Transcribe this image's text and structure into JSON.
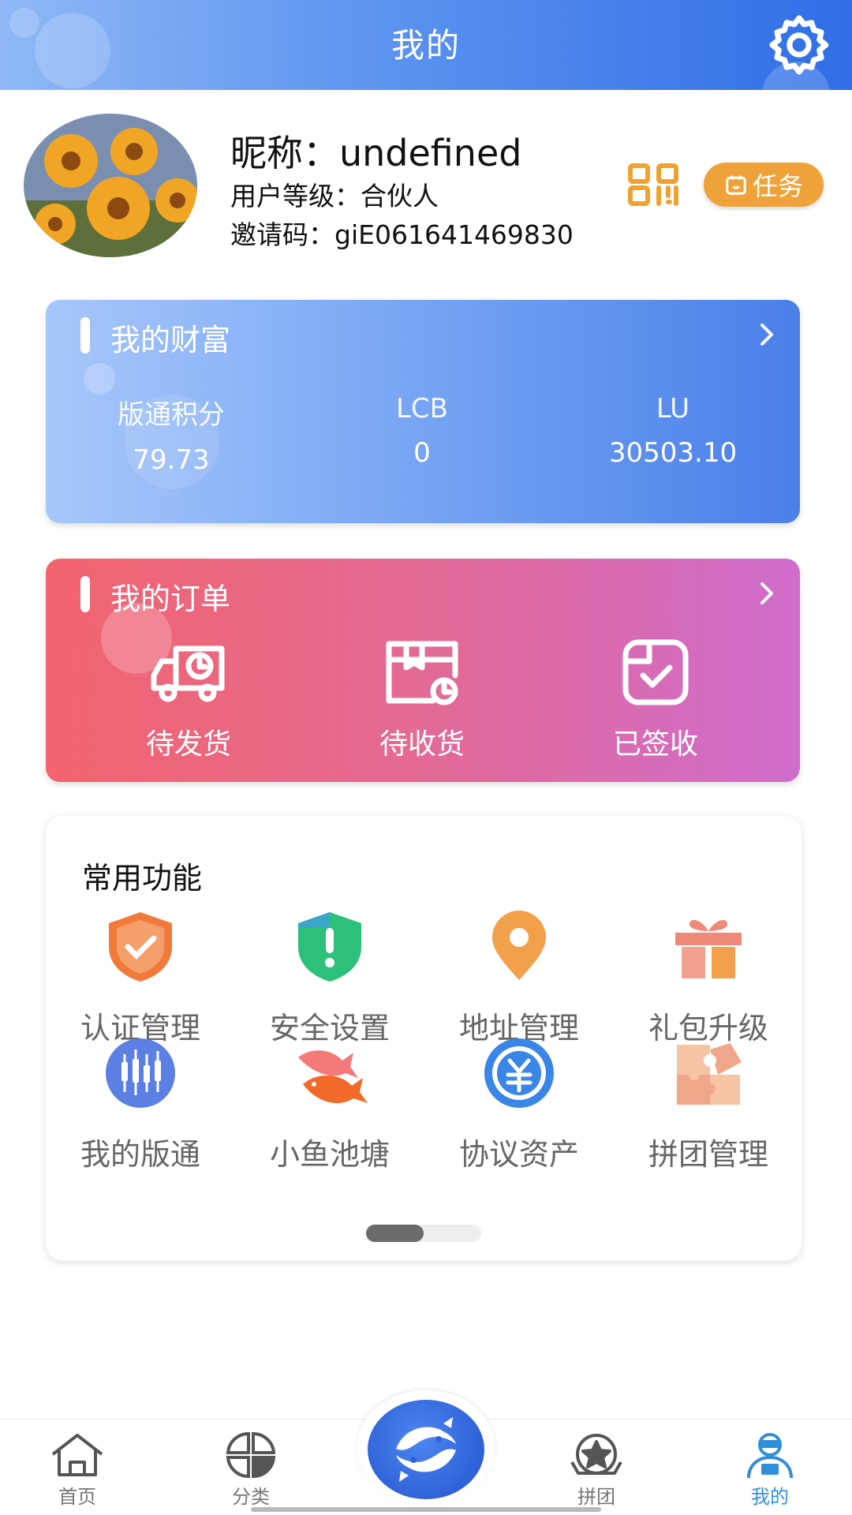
{
  "header": {
    "title": "我的"
  },
  "profile": {
    "nickname": "昵称：undefined",
    "level": "用户等级：合伙人",
    "invite_code": "邀请码：giE061641469830",
    "task_label": "任务"
  },
  "wealth": {
    "title": "我的财富",
    "stats": [
      {
        "label": "版通积分",
        "value": "79.73"
      },
      {
        "label": "LCB",
        "value": "0"
      },
      {
        "label": "LU",
        "value": "30503.10"
      }
    ]
  },
  "orders": {
    "title": "我的订单",
    "items": [
      {
        "label": "待发货",
        "icon": "delivery-truck-icon"
      },
      {
        "label": "待收货",
        "icon": "package-clock-icon"
      },
      {
        "label": "已签收",
        "icon": "signed-check-icon"
      }
    ]
  },
  "functions": {
    "title": "常用功能",
    "items": [
      {
        "label": "认证管理",
        "icon": "shield-check-icon",
        "color": "#f07a3a"
      },
      {
        "label": "安全设置",
        "icon": "shield-alert-icon",
        "color": "#2cc07a"
      },
      {
        "label": "地址管理",
        "icon": "location-pin-icon",
        "color": "#f2a04a"
      },
      {
        "label": "礼包升级",
        "icon": "gift-icon",
        "color": "#f08a78"
      },
      {
        "label": "我的版通",
        "icon": "candlestick-icon",
        "color": "#5b7fe2"
      },
      {
        "label": "小鱼池塘",
        "icon": "fish-icon",
        "color": "#f26a4a"
      },
      {
        "label": "协议资产",
        "icon": "yuan-coin-icon",
        "color": "#3a86e6"
      },
      {
        "label": "拼团管理",
        "icon": "puzzle-icon",
        "color": "#f0a68a"
      }
    ],
    "page_progress": 0.5
  },
  "tabbar": {
    "items": [
      {
        "label": "首页",
        "icon": "home-icon"
      },
      {
        "label": "分类",
        "icon": "category-icon"
      },
      {
        "label": "拼团",
        "icon": "star-badge-icon"
      },
      {
        "label": "我的",
        "icon": "profile-icon",
        "active": true
      }
    ]
  }
}
